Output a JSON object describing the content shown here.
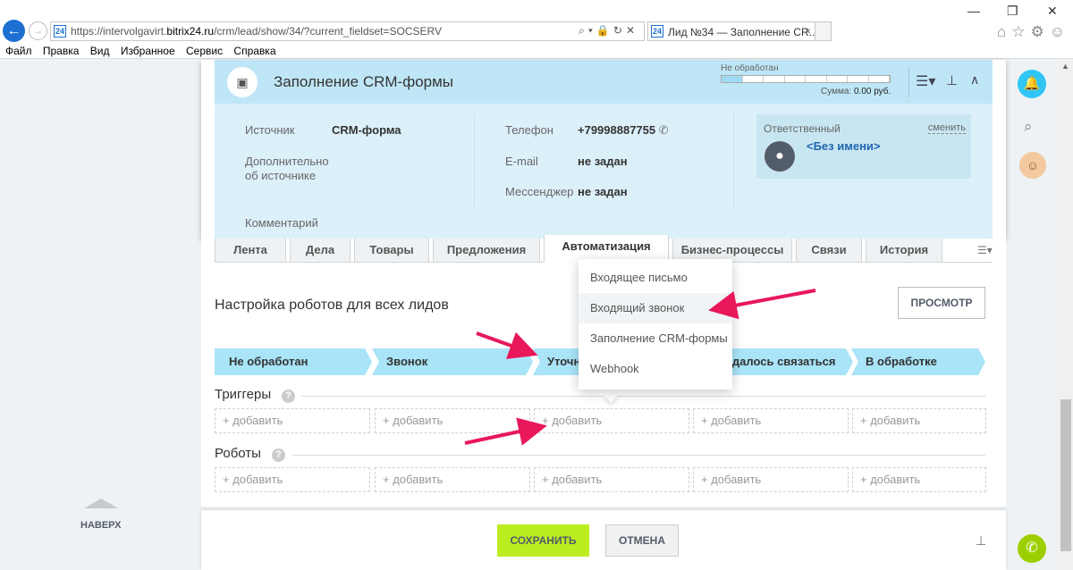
{
  "browser": {
    "url_prefix": "https://intervolgavirt.",
    "url_domain": "bitrix24.ru",
    "url_path": "/crm/lead/show/34/?current_fieldset=SOCSERV",
    "favicon": "24",
    "tab_title": "Лид №34 — Заполнение CR...",
    "tab_close": "×",
    "menu": [
      "Файл",
      "Правка",
      "Вид",
      "Избранное",
      "Сервис",
      "Справка"
    ]
  },
  "lead": {
    "title": "Заполнение CRM-формы",
    "status_label": "Не обработан",
    "sum_label": "Сумма:",
    "sum_value": "0.00 руб.",
    "fields": {
      "source_label": "Источник",
      "source_value": "CRM-форма",
      "source_info_label_1": "Дополнительно",
      "source_info_label_2": "об источнике",
      "comment_label": "Комментарий",
      "phone_label": "Телефон",
      "phone_value": "+79998887755",
      "email_label": "E-mail",
      "email_value": "не задан",
      "messenger_label": "Мессенджер",
      "messenger_value": "не задан"
    },
    "responsible": {
      "label": "Ответственный",
      "change": "сменить",
      "name": "<Без имени>"
    }
  },
  "tabs": [
    "Лента",
    "Дела",
    "Товары",
    "Предложения",
    "Автоматизация",
    "Бизнес-процессы",
    "Связи",
    "История"
  ],
  "automation": {
    "title": "Настройка роботов для всех лидов",
    "preview_button": "ПРОСМОТР",
    "stages": [
      "Не обработан",
      "Звонок",
      "Уточн",
      "удалось связаться",
      "В обработке"
    ],
    "stage_color": "#a9e4f8",
    "triggers_label": "Триггеры",
    "robots_label": "Роботы",
    "help": "?",
    "add_label": "+ добавить"
  },
  "dropdown": {
    "items": [
      "Входящее письмо",
      "Входящий звонок",
      "Заполнение CRM-формы",
      "Webhook"
    ]
  },
  "footer": {
    "save": "СОХРАНИТЬ",
    "cancel": "ОТМЕНА"
  },
  "sidebar_left": {
    "up_label": "НАВЕРХ"
  },
  "colors": {
    "accent_blue": "#2fc6f6",
    "save_green": "#bbed21",
    "phone_green": "#9dcf00",
    "annotation_arrow": "#e8185a"
  }
}
